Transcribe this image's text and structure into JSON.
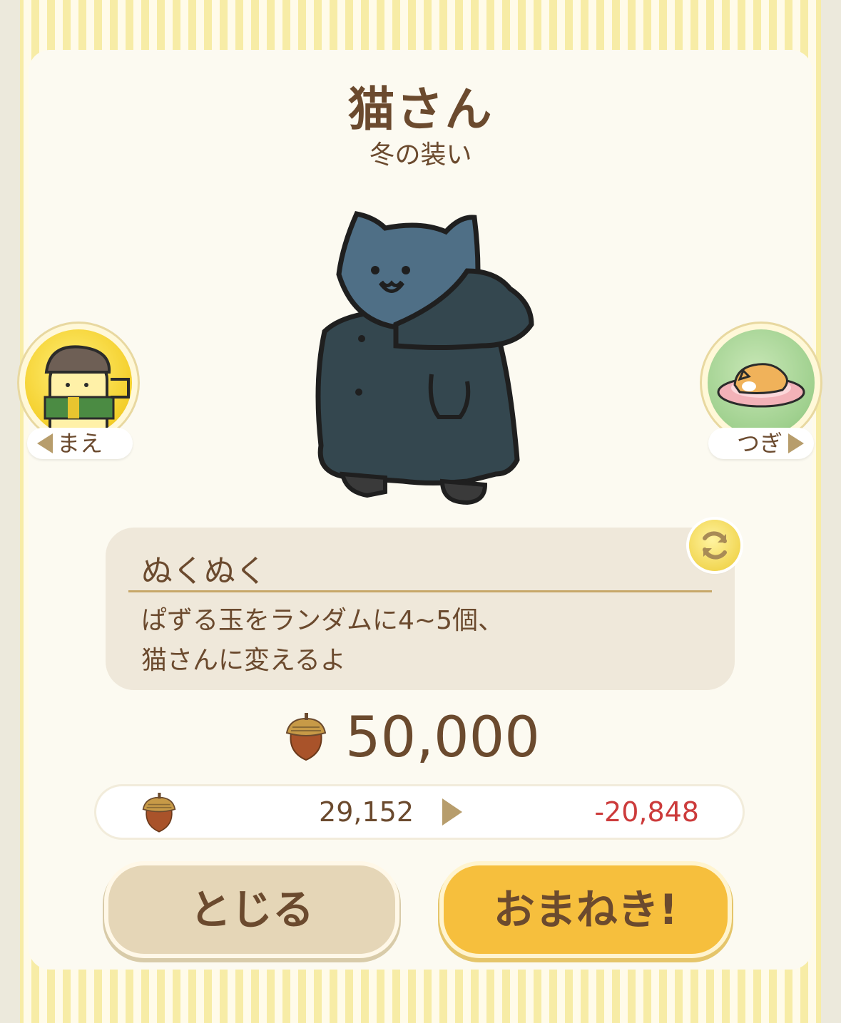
{
  "title": "猫さん",
  "subtitle": "冬の装い",
  "nav": {
    "prev_label": "まえ",
    "next_label": "つぎ"
  },
  "skill": {
    "name": "ぬくぬく",
    "description_line1": "ぱずる玉をランダムに4~5個、",
    "description_line2": "猫さんに変えるよ"
  },
  "price": "50,000",
  "balance": {
    "current": "29,152",
    "difference": "-20,848"
  },
  "buttons": {
    "close": "とじる",
    "summon": "おまねき!"
  },
  "colors": {
    "text": "#6b4a2e",
    "negative": "#cc3b3b",
    "summon_button": "#f6bf3d",
    "close_button": "#e5d6b7"
  },
  "icons": [
    "cat-character-icon",
    "previous-cat-icon",
    "next-cat-icon",
    "refresh-icon",
    "acorn-icon"
  ]
}
